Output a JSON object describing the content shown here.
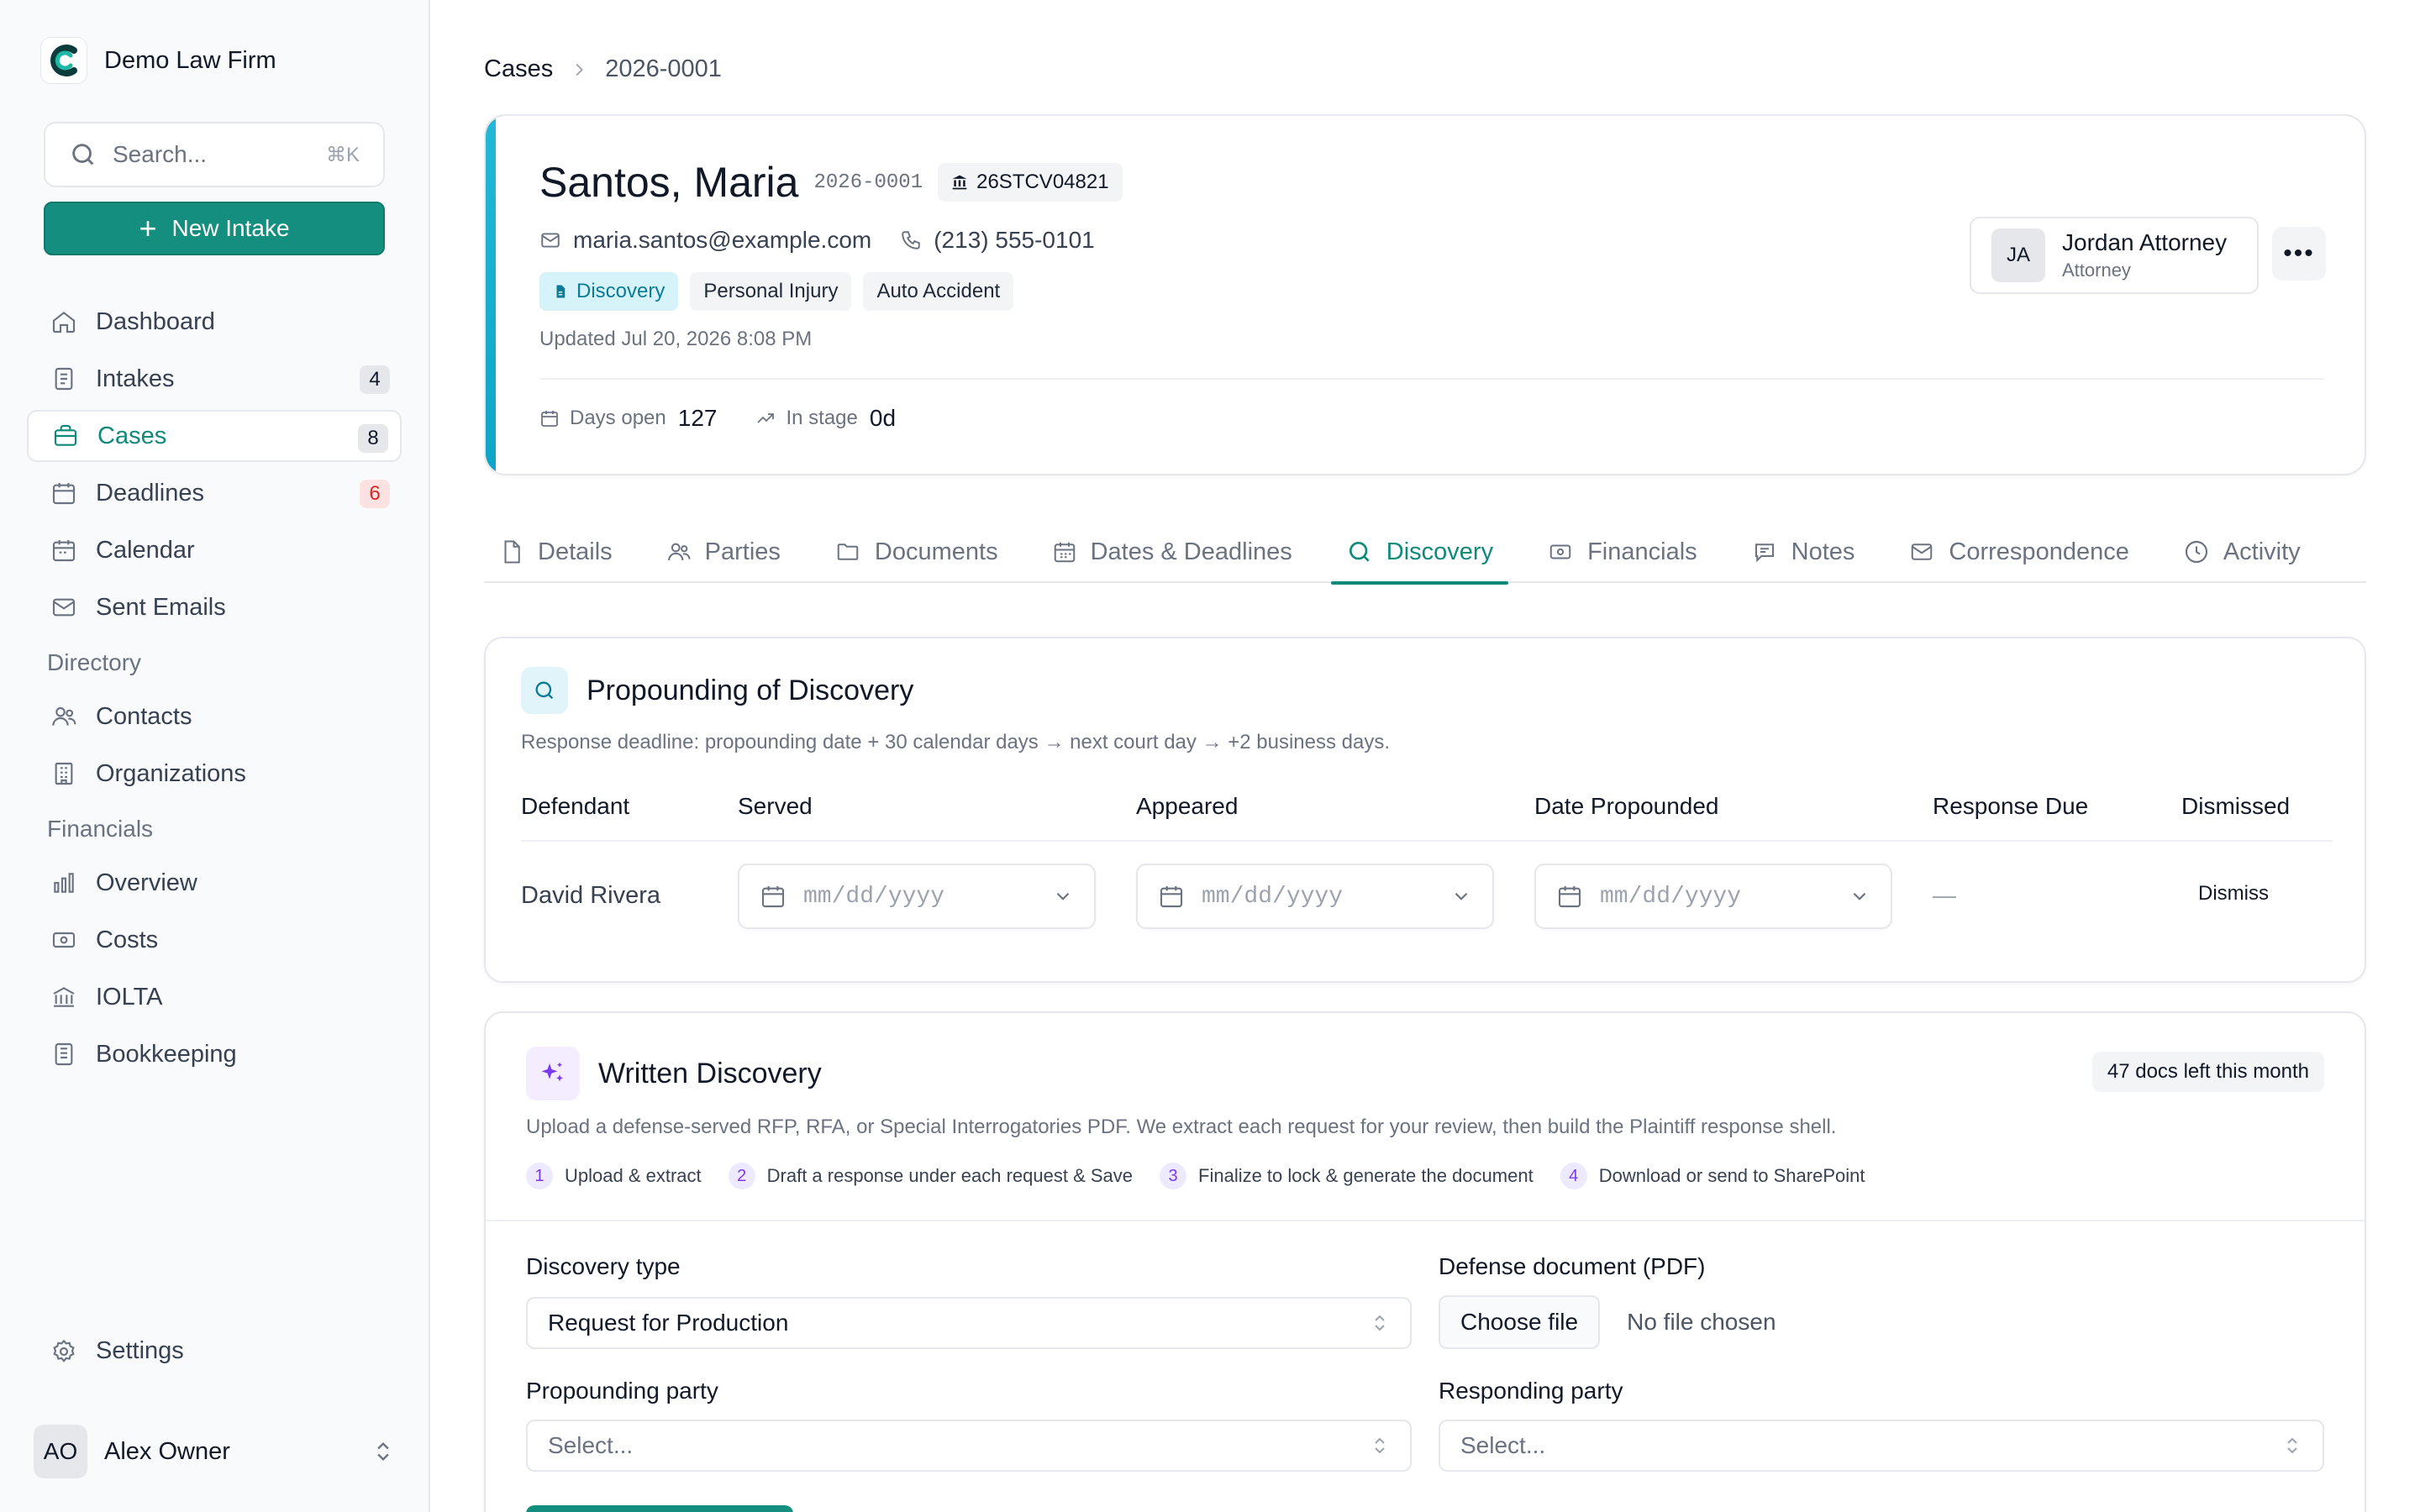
{
  "sidebar": {
    "brand": "Demo Law Firm",
    "search": {
      "placeholder": "Search...",
      "shortcut": "⌘K"
    },
    "new_intake": "New Intake",
    "nav": [
      {
        "label": "Dashboard",
        "icon": "home-icon"
      },
      {
        "label": "Intakes",
        "icon": "intake-icon",
        "badge": "4"
      },
      {
        "label": "Cases",
        "icon": "briefcase-icon",
        "badge": "8",
        "active": true
      },
      {
        "label": "Deadlines",
        "icon": "calendar-icon",
        "badge": "6"
      },
      {
        "label": "Calendar",
        "icon": "calendar-icon"
      },
      {
        "label": "Sent Emails",
        "icon": "mail-icon"
      }
    ],
    "directory_heading": "Directory",
    "directory": [
      {
        "label": "Contacts",
        "icon": "users-icon"
      },
      {
        "label": "Organizations",
        "icon": "building-icon"
      }
    ],
    "financials_heading": "Financials",
    "financials": [
      {
        "label": "Overview",
        "icon": "bar-chart-icon"
      },
      {
        "label": "Costs",
        "icon": "money-icon"
      },
      {
        "label": "IOLTA",
        "icon": "bank-icon"
      },
      {
        "label": "Bookkeeping",
        "icon": "ledger-icon"
      }
    ],
    "settings": "Settings",
    "user": {
      "initials": "AO",
      "name": "Alex Owner"
    }
  },
  "breadcrumb": {
    "parent": "Cases",
    "separator": ">",
    "current": "2026-0001"
  },
  "case": {
    "name": "Santos, Maria",
    "number": "2026-0001",
    "court_number": "26STCV04821",
    "email": "maria.santos@example.com",
    "phone": "(213) 555-0101",
    "stage": "Discovery",
    "tags": [
      "Personal Injury",
      "Auto Accident"
    ],
    "updated": "Updated Jul 20, 2026 8:08 PM",
    "days_open_label": "Days open",
    "days_open": "127",
    "in_stage_label": "In stage",
    "in_stage": "0d",
    "assignee": {
      "initials": "JA",
      "name": "Jordan Attorney",
      "role": "Attorney"
    },
    "more": "•••",
    "accent_color": "#1cb3d3"
  },
  "tabs": [
    {
      "label": "Details",
      "icon": "document-icon"
    },
    {
      "label": "Parties",
      "icon": "users-icon"
    },
    {
      "label": "Documents",
      "icon": "folder-icon"
    },
    {
      "label": "Dates & Deadlines",
      "icon": "calendar-icon"
    },
    {
      "label": "Discovery",
      "icon": "search-icon",
      "active": true
    },
    {
      "label": "Financials",
      "icon": "money-icon"
    },
    {
      "label": "Notes",
      "icon": "chat-icon"
    },
    {
      "label": "Correspondence",
      "icon": "mail-icon"
    },
    {
      "label": "Activity",
      "icon": "clock-icon"
    }
  ],
  "propounding": {
    "title": "Propounding of Discovery",
    "subtitle": "Response deadline: propounding date + 30 calendar days → next court day → +2 business days.",
    "columns": [
      "Defendant",
      "Served",
      "Appeared",
      "Date Propounded",
      "Response Due",
      "Dismissed"
    ],
    "rows": [
      {
        "defendant": "David Rivera",
        "served": "mm/dd/yyyy",
        "appeared": "mm/dd/yyyy",
        "date_propounded": "mm/dd/yyyy",
        "response_due": "—",
        "dismiss": "Dismiss"
      }
    ]
  },
  "written_discovery": {
    "title": "Written Discovery",
    "quota": "47 docs left this month",
    "subtitle": "Upload a defense-served RFP, RFA, or Special Interrogatories PDF. We extract each request for your review, then build the Plaintiff response shell.",
    "steps": [
      {
        "num": "1",
        "label": "Upload & extract"
      },
      {
        "num": "2",
        "label": "Draft a response under each request & Save"
      },
      {
        "num": "3",
        "label": "Finalize to lock & generate the document"
      },
      {
        "num": "4",
        "label": "Download or send to SharePoint"
      }
    ],
    "discovery_type_label": "Discovery type",
    "discovery_type_value": "Request for Production",
    "defense_doc_label": "Defense document (PDF)",
    "choose_file": "Choose file",
    "file_status": "No file chosen",
    "propounding_party_label": "Propounding party",
    "propounding_party_placeholder": "Select...",
    "responding_party_label": "Responding party",
    "responding_party_placeholder": "Select..."
  },
  "colors": {
    "brand": "#148f7f",
    "active_text": "#0f8a7a",
    "badge_red": "#dc2626",
    "step_purple": "#7c3aed"
  }
}
